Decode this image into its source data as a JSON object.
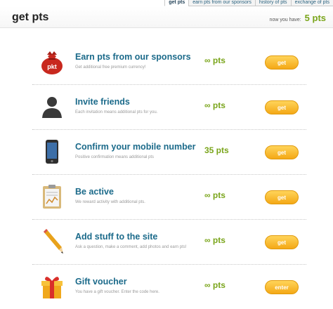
{
  "tabs": [
    "get pts",
    "earn pts from our sponsors",
    "history of pts",
    "exchange of pts"
  ],
  "header": {
    "title": "get pts",
    "balance_label": "now you have:",
    "balance_value": "5 pts"
  },
  "items": [
    {
      "icon": "money-bag-icon",
      "icon_text": "pkt",
      "title": "Earn pts from our sponsors",
      "description": "Get additional free premium currency!",
      "points": "∞ pts",
      "button": "get"
    },
    {
      "icon": "person-icon",
      "title": "Invite friends",
      "description": "Each invitation means additional pts for you.",
      "points": "∞ pts",
      "button": "get"
    },
    {
      "icon": "mobile-phone-icon",
      "title": "Confirm your mobile number",
      "description": "Positive confirmation means additional pts",
      "points": "35 pts",
      "button": "get"
    },
    {
      "icon": "clipboard-chart-icon",
      "title": "Be active",
      "description": "We reward activity with additional pts.",
      "points": "∞ pts",
      "button": "get"
    },
    {
      "icon": "pencil-icon",
      "title": "Add stuff to the site",
      "description": "Ask a question, make a comment, add photos and earn pts!",
      "points": "∞ pts",
      "button": "get"
    },
    {
      "icon": "gift-icon",
      "title": "Gift voucher",
      "description": "You have a gift voucher. Enter the code here.",
      "points": "∞ pts",
      "button": "enter"
    }
  ],
  "colors": {
    "title_blue": "#1b6a8a",
    "points_green": "#7aa51b",
    "button_orange": "#f4a816"
  }
}
